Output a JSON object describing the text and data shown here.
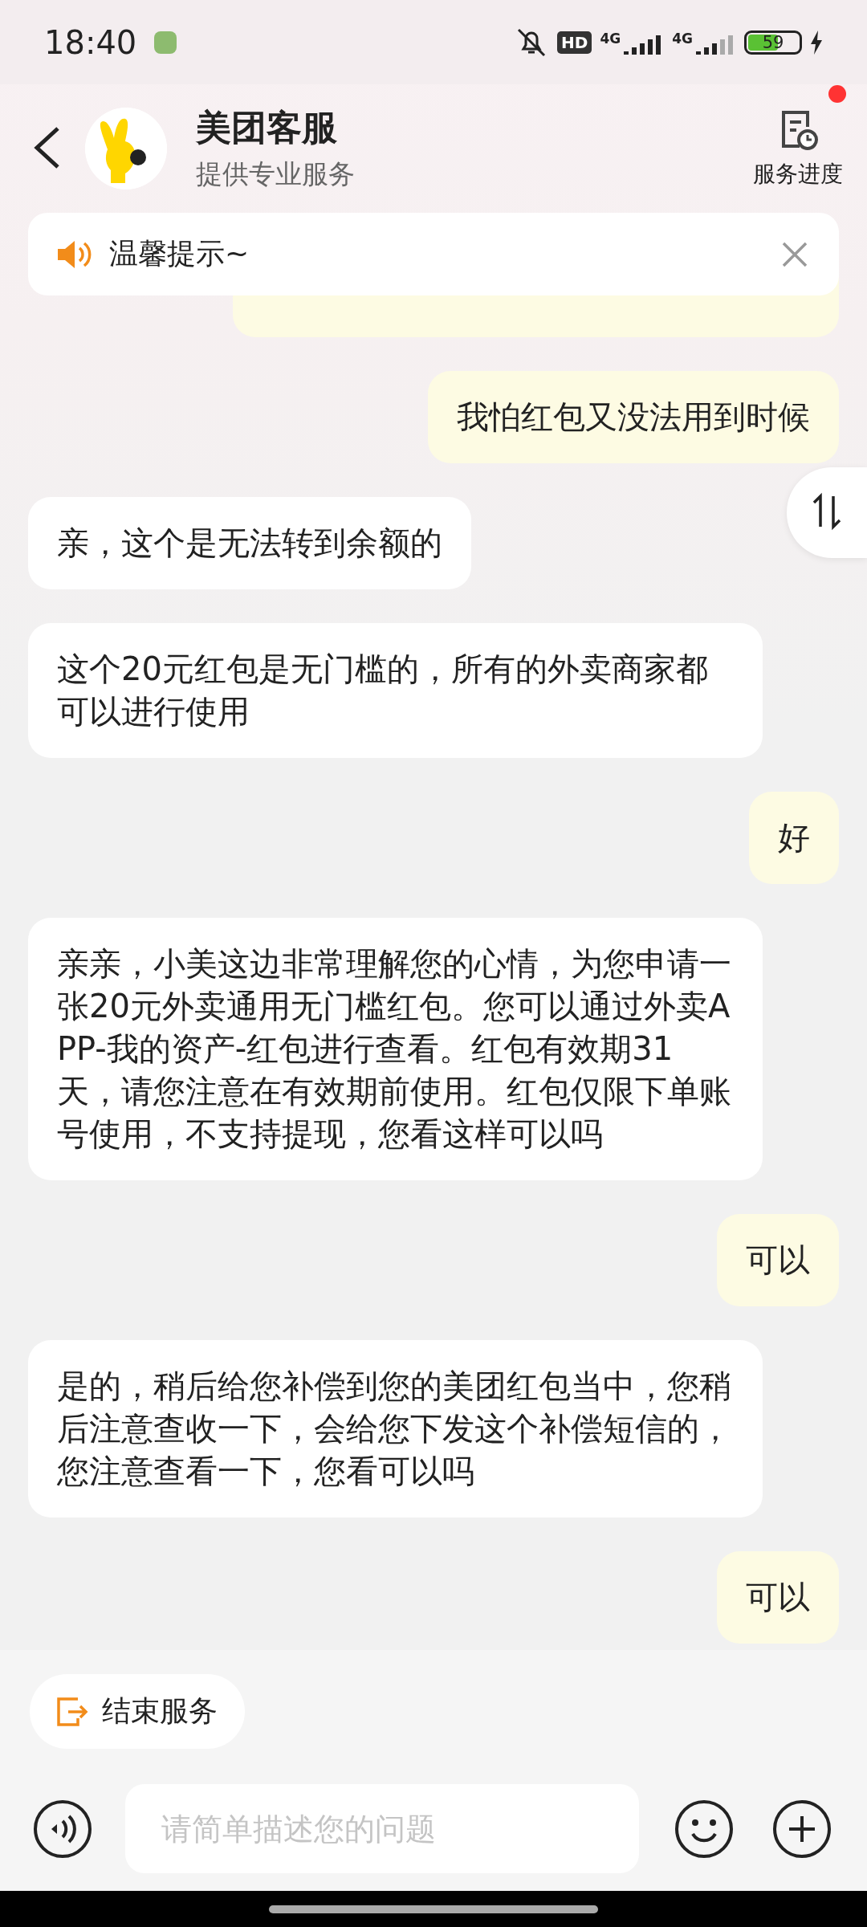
{
  "status_bar": {
    "time": "18:40",
    "hd_label": "HD",
    "network_labels": [
      "4G",
      "4G"
    ],
    "battery": "59",
    "charging": true
  },
  "header": {
    "title": "美团客服",
    "subtitle": "提供专业服务",
    "progress_label": "服务进度",
    "unread_dot": true
  },
  "notice": {
    "text": "温馨提示~"
  },
  "messages": [
    {
      "outgoing": true,
      "kind": "partial"
    },
    {
      "outgoing": true,
      "kind": "text",
      "text": "我怕红包又没法用到时候"
    },
    {
      "outgoing": false,
      "kind": "text",
      "text": "亲，这个是无法转到余额的"
    },
    {
      "outgoing": false,
      "kind": "text",
      "text": "这个20元红包是无门槛的，所有的外卖商家都可以进行使用"
    },
    {
      "outgoing": true,
      "kind": "text",
      "text": "好"
    },
    {
      "outgoing": false,
      "kind": "text",
      "text": "亲亲，小美这边非常理解您的心情，为您申请一张20元外卖通用无门槛红包。您可以通过外卖APP-我的资产-红包进行查看。红包有效期31天，请您注意在有效期前使用。红包仅限下单账号使用，不支持提现，您看这样可以吗"
    },
    {
      "outgoing": true,
      "kind": "text",
      "text": "可以"
    },
    {
      "outgoing": false,
      "kind": "text",
      "text": "是的，稍后给您补偿到您的美团红包当中，您稍后注意查收一下，会给您下发这个补偿短信的，您注意查看一下，您看可以吗"
    },
    {
      "outgoing": true,
      "kind": "text",
      "text": "可以"
    }
  ],
  "end_service": {
    "label": "结束服务"
  },
  "input": {
    "placeholder": "请简单描述您的问题"
  }
}
